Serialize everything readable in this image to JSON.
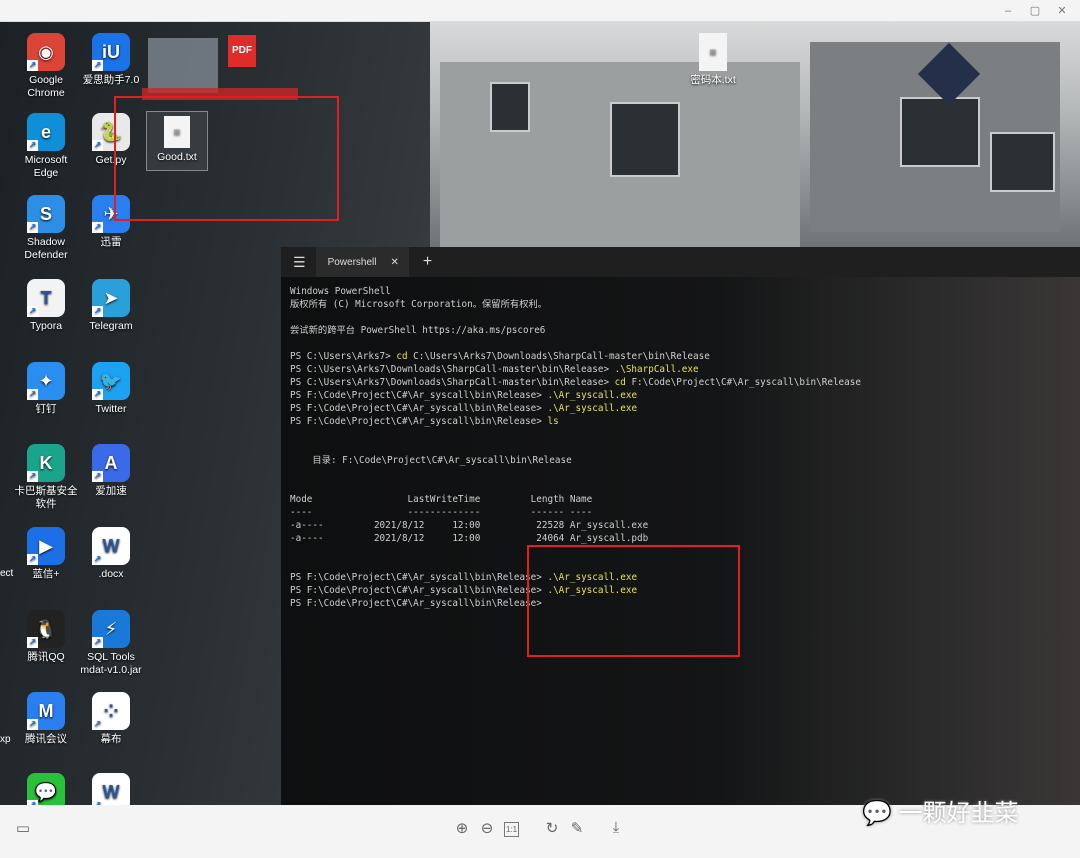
{
  "window_controls": {
    "minimize": "–",
    "maximize": "▢",
    "close": "✕"
  },
  "desktop": {
    "icons": [
      {
        "label": "Google Chrome",
        "color": "#db4437",
        "glyph": "◉"
      },
      {
        "label": "爱思助手7.0",
        "color": "#1a73e8",
        "glyph": "iU"
      },
      {
        "label": "Microsoft Edge",
        "color": "#0f8fd8",
        "glyph": "e"
      },
      {
        "label": "Get.py",
        "color": "#e9e9e9",
        "glyph": "🐍"
      },
      {
        "label": "Shadow Defender",
        "color": "#2e8ee6",
        "glyph": "S"
      },
      {
        "label": "迅雷",
        "color": "#2a7ff0",
        "glyph": "✈"
      },
      {
        "label": "Typora",
        "color": "#f3f3f3",
        "glyph": "T"
      },
      {
        "label": "Telegram",
        "color": "#2aa0da",
        "glyph": "➤"
      },
      {
        "label": "钉钉",
        "color": "#2a8ef0",
        "glyph": "✦"
      },
      {
        "label": "Twitter",
        "color": "#1da1f2",
        "glyph": "🐦"
      },
      {
        "label": "卡巴斯基安全软件",
        "color": "#1aa48c",
        "glyph": "K"
      },
      {
        "label": "爱加速",
        "color": "#3a6ae8",
        "glyph": "A"
      },
      {
        "label": "蓝信+",
        "color": "#1d6fe6",
        "glyph": "▶"
      },
      {
        "label": ".docx",
        "color": "#ffffff",
        "glyph": "W"
      },
      {
        "label": "腾讯QQ",
        "color": "#222222",
        "glyph": "🐧"
      },
      {
        "label": "SQL Tools mdat-v1.0.jar",
        "color": "#1a78d8",
        "glyph": "⚡"
      },
      {
        "label": "腾讯会议",
        "color": "#2a7ff0",
        "glyph": "M"
      },
      {
        "label": "幕布",
        "color": "#ffffff",
        "glyph": "⁘"
      },
      {
        "label": "",
        "color": "#2ac13a",
        "glyph": "💬"
      },
      {
        "label": "",
        "color": "#ffffff",
        "glyph": "W"
      }
    ],
    "top_files": [
      {
        "label": "Good.txt"
      },
      {
        "label": "密码本.txt"
      }
    ],
    "partial_labels": [
      "ect",
      "xp"
    ]
  },
  "terminal": {
    "tab_label": "Powershell",
    "lines": [
      {
        "prompt": "Windows PowerShell",
        "cmd": ""
      },
      {
        "prompt": "版权所有 (C) Microsoft Corporation。保留所有权利。",
        "cmd": ""
      },
      {
        "prompt": "",
        "cmd": ""
      },
      {
        "prompt": "尝试新的跨平台 PowerShell https://aka.ms/pscore6",
        "cmd": ""
      },
      {
        "prompt": "",
        "cmd": ""
      },
      {
        "prompt": "PS C:\\Users\\Arks7> ",
        "cmd": "cd",
        "rest": " C:\\Users\\Arks7\\Downloads\\SharpCall-master\\bin\\Release"
      },
      {
        "prompt": "PS C:\\Users\\Arks7\\Downloads\\SharpCall-master\\bin\\Release> ",
        "cmd": ".\\SharpCall.exe"
      },
      {
        "prompt": "PS C:\\Users\\Arks7\\Downloads\\SharpCall-master\\bin\\Release> ",
        "cmd": "cd",
        "rest": " F:\\Code\\Project\\C#\\Ar_syscall\\bin\\Release"
      },
      {
        "prompt": "PS F:\\Code\\Project\\C#\\Ar_syscall\\bin\\Release> ",
        "cmd": ".\\Ar_syscall.exe"
      },
      {
        "prompt": "PS F:\\Code\\Project\\C#\\Ar_syscall\\bin\\Release> ",
        "cmd": ".\\Ar_syscall.exe"
      },
      {
        "prompt": "PS F:\\Code\\Project\\C#\\Ar_syscall\\bin\\Release> ",
        "cmd": "ls"
      },
      {
        "prompt": "",
        "cmd": ""
      },
      {
        "prompt": "",
        "cmd": ""
      },
      {
        "prompt": "    目录: F:\\Code\\Project\\C#\\Ar_syscall\\bin\\Release",
        "cmd": ""
      },
      {
        "prompt": "",
        "cmd": ""
      },
      {
        "prompt": "",
        "cmd": ""
      },
      {
        "prompt": "Mode                 LastWriteTime         Length Name",
        "cmd": ""
      },
      {
        "prompt": "----                 -------------         ------ ----",
        "cmd": ""
      },
      {
        "prompt": "-a----         2021/8/12     12:00          22528 Ar_syscall.exe",
        "cmd": ""
      },
      {
        "prompt": "-a----         2021/8/12     12:00          24064 Ar_syscall.pdb",
        "cmd": ""
      },
      {
        "prompt": "",
        "cmd": ""
      },
      {
        "prompt": "",
        "cmd": ""
      },
      {
        "prompt": "PS F:\\Code\\Project\\C#\\Ar_syscall\\bin\\Release> ",
        "cmd": ".\\Ar_syscall.exe"
      },
      {
        "prompt": "PS F:\\Code\\Project\\C#\\Ar_syscall\\bin\\Release> ",
        "cmd": ".\\Ar_syscall.exe"
      },
      {
        "prompt": "PS F:\\Code\\Project\\C#\\Ar_syscall\\bin\\Release>",
        "cmd": ""
      }
    ]
  },
  "viewer_toolbar": {
    "zoom_in": "⊕",
    "zoom_out": "⊖",
    "actual_size": "1:1",
    "rotate": "↻",
    "edit": "✎",
    "download": "⤓",
    "layout": "▭"
  },
  "watermark": "一颗好韭菜",
  "colors": {
    "highlight_box": "#e02020",
    "command_text": "#e8e05a"
  }
}
